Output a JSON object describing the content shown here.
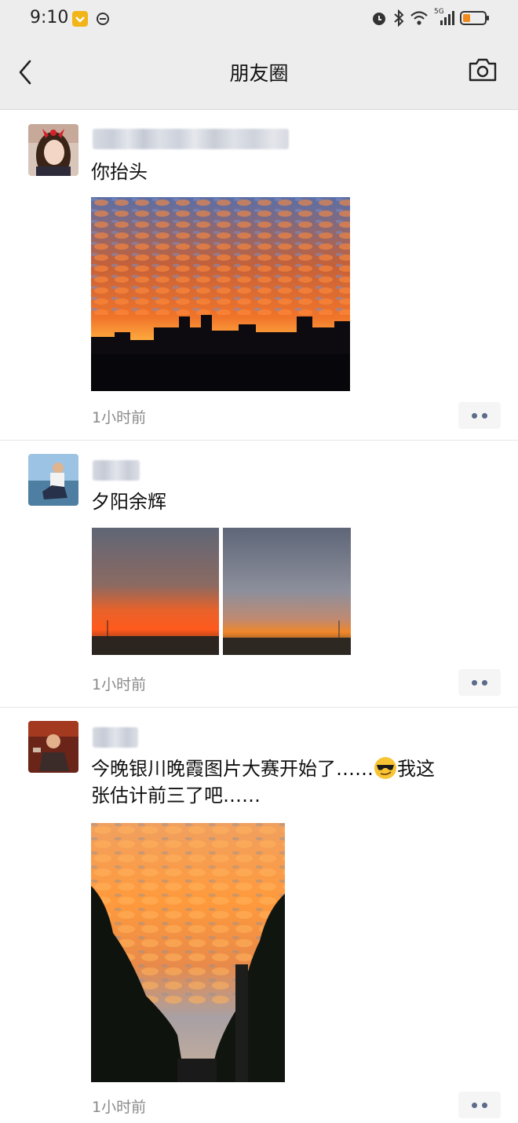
{
  "status_bar": {
    "time": "9:10",
    "icons": [
      "shield-icon",
      "link-icon",
      "alarm-icon",
      "bluetooth-icon",
      "wifi-icon",
      "5g-signal-icon",
      "battery-icon"
    ],
    "network_label": "5G"
  },
  "header": {
    "title": "朋友圈",
    "back_icon": "chevron-left-icon",
    "camera_icon": "camera-icon"
  },
  "posts": [
    {
      "text": "你抬头",
      "time": "1小时前",
      "photos": [
        "city-skyline-sunset-clouds"
      ]
    },
    {
      "text": "夕阳余辉",
      "time": "1小时前",
      "photos": [
        "orange-horizon-sunset",
        "grey-clouds-sunset"
      ]
    },
    {
      "text_line1": "今晚银川晚霞图片大赛开始了……",
      "text_line2": "我这",
      "text_line3": "张估计前三了吧……",
      "emoji": "sunglasses-emoji",
      "time": "1小时前",
      "photos": [
        "street-trees-orange-clouds"
      ]
    }
  ],
  "colors": {
    "header_bg": "#ededed",
    "more_dots": "#5c6b8a",
    "timestamp": "#8a8a8a"
  }
}
